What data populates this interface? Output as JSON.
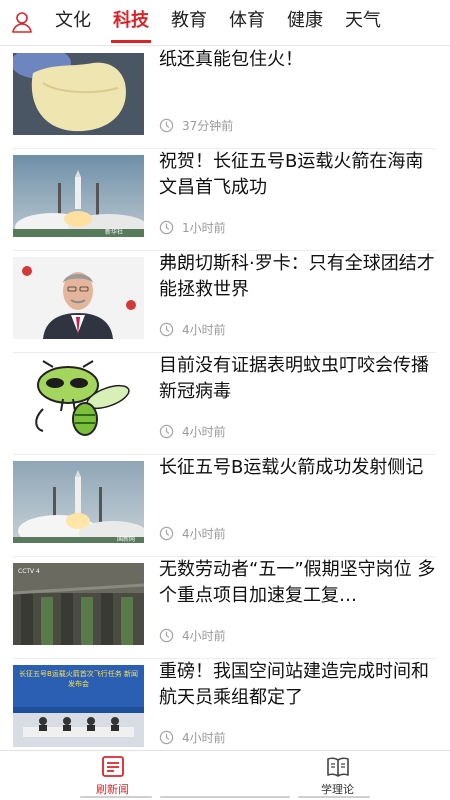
{
  "colors": {
    "accent": "#d7262b",
    "meta_text": "#9a9a9a"
  },
  "header": {
    "user_icon": "user-icon",
    "tabs": [
      {
        "label": "文化",
        "active": false
      },
      {
        "label": "科技",
        "active": true
      },
      {
        "label": "教育",
        "active": false
      },
      {
        "label": "体育",
        "active": false
      },
      {
        "label": "健康",
        "active": false
      },
      {
        "label": "天气",
        "active": false
      }
    ]
  },
  "news": [
    {
      "title": "纸还真能包住火！",
      "time": "37分钟前",
      "thumb": "paper-bag"
    },
    {
      "title": "祝贺！长征五号B运载火箭在海南文昌首飞成功",
      "time": "1小时前",
      "thumb": "rocket-launch",
      "thumb_caption": "新华社"
    },
    {
      "title": "弗朗切斯科·罗卡：只有全球团结才能拯救世界",
      "time": "4小时前",
      "thumb": "portrait"
    },
    {
      "title": "目前没有证据表明蚊虫叮咬会传播新冠病毒",
      "time": "4小时前",
      "thumb": "mosquito-cartoon"
    },
    {
      "title": "长征五号B运载火箭成功发射侧记",
      "time": "4小时前",
      "thumb": "rocket-launch",
      "thumb_caption": "国新网"
    },
    {
      "title": "无数劳动者“五一”假期坚守岗位 多个重点项目加速复工复…",
      "time": "4小时前",
      "thumb": "construction",
      "thumb_caption": "CCTV 4"
    },
    {
      "title": "重磅！我国空间站建造完成时间和航天员乘组都定了",
      "time": "4小时前",
      "thumb": "press-conference",
      "thumb_caption": "长征五号B运载火箭首次飞行任务 新闻发布会"
    }
  ],
  "bottom_nav": [
    {
      "label": "刷新闻",
      "icon": "news-icon",
      "active": true
    },
    {
      "label": "学理论",
      "icon": "book-icon",
      "active": false
    }
  ]
}
